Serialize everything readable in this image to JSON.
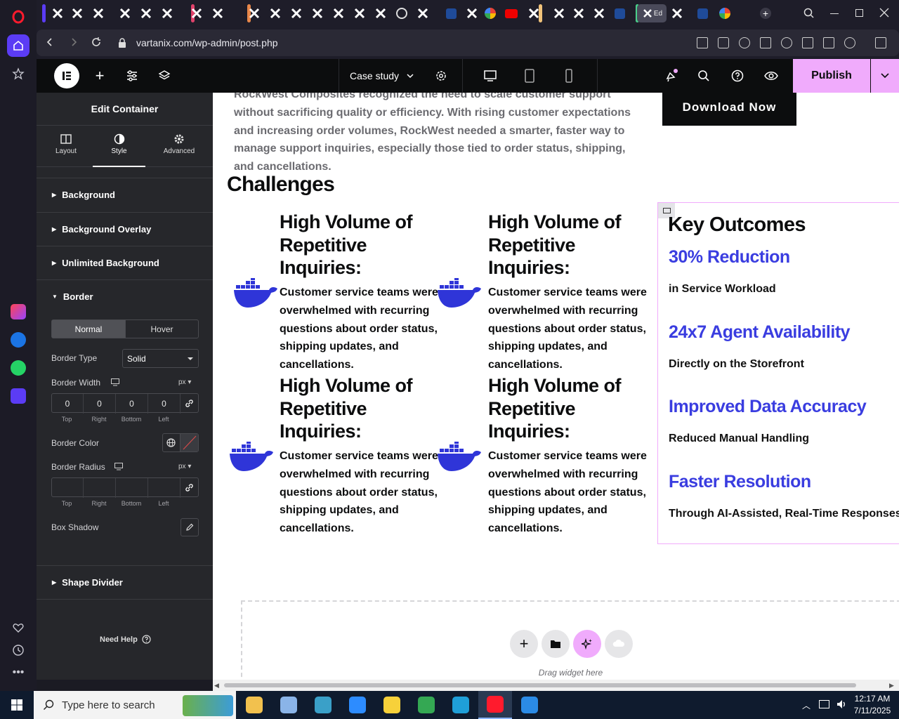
{
  "browser": {
    "url": "vartanix.com/wp-admin/post.php",
    "active_tab_label": "Ed"
  },
  "elementor": {
    "page_selector": "Case study",
    "publish_label": "Publish"
  },
  "panel": {
    "title": "Edit Container",
    "tabs": [
      {
        "label": "Layout",
        "icon": "layout-icon"
      },
      {
        "label": "Style",
        "icon": "style-icon",
        "active": true
      },
      {
        "label": "Advanced",
        "icon": "gear-icon"
      }
    ],
    "sections": {
      "background": "Background",
      "background_overlay": "Background Overlay",
      "unlimited_background": "Unlimited Background",
      "border": "Border",
      "shape_divider": "Shape Divider"
    },
    "state_tabs": {
      "normal": "Normal",
      "hover": "Hover"
    },
    "border_type": {
      "label": "Border Type",
      "value": "Solid"
    },
    "border_width": {
      "label": "Border Width",
      "unit": "px",
      "values": [
        "0",
        "0",
        "0",
        "0"
      ]
    },
    "sides": [
      "Top",
      "Right",
      "Bottom",
      "Left"
    ],
    "border_color": {
      "label": "Border Color"
    },
    "border_radius": {
      "label": "Border Radius",
      "unit": "px"
    },
    "box_shadow": {
      "label": "Box Shadow"
    },
    "need_help": "Need Help"
  },
  "canvas": {
    "intro": "RockWest Composites recognized the need to scale customer support without sacrificing quality or efficiency. With rising customer expectations and increasing order volumes, RockWest needed a smarter, faster way to manage support inquiries, especially those tied to order status, shipping, and cancellations.",
    "download_button": "Download Now",
    "challenges_title": "Challenges",
    "challenge_cards": [
      {
        "title_lines": [
          "High Volume of",
          "Repetitive",
          "Inquiries:"
        ],
        "body_lines": [
          "Customer service teams were",
          "overwhelmed with recurring",
          "questions about order status,",
          "shipping updates, and",
          "cancellations."
        ]
      },
      {
        "title_lines": [
          "High Volume of",
          "Repetitive",
          "Inquiries:"
        ],
        "body_lines": [
          "Customer service teams were",
          "overwhelmed with recurring",
          "questions about order status,",
          "shipping updates, and",
          "cancellations."
        ]
      },
      {
        "title_lines": [
          "High Volume of",
          "Repetitive",
          "Inquiries:"
        ],
        "body_lines": [
          "Customer service teams were",
          "overwhelmed with recurring",
          "questions about order status,",
          "shipping updates, and",
          "cancellations."
        ]
      },
      {
        "title_lines": [
          "High Volume of",
          "Repetitive",
          "Inquiries:"
        ],
        "body_lines": [
          "Customer service teams were",
          "overwhelmed with recurring",
          "questions about order status,",
          "shipping updates, and",
          "cancellations."
        ]
      }
    ],
    "key_outcomes": {
      "title": "Key Outcomes",
      "items": [
        {
          "headline": "30% Reduction",
          "detail": "in Service Workload"
        },
        {
          "headline": "24x7 Agent Availability",
          "detail": "Directly on the Storefront"
        },
        {
          "headline": "Improved Data Accuracy",
          "detail": "Reduced Manual Handling"
        },
        {
          "headline": "Faster Resolution",
          "detail": "Through AI-Assisted, Real-Time Responses"
        }
      ]
    },
    "drag_hint": "Drag widget here"
  },
  "taskbar": {
    "search_placeholder": "Type here to search",
    "time": "12:17 AM",
    "date": "7/11/2025"
  },
  "colors": {
    "accent_blue": "#3a3de0",
    "publish_bg": "#f0abfc",
    "docker_blue": "#2f35d8"
  }
}
